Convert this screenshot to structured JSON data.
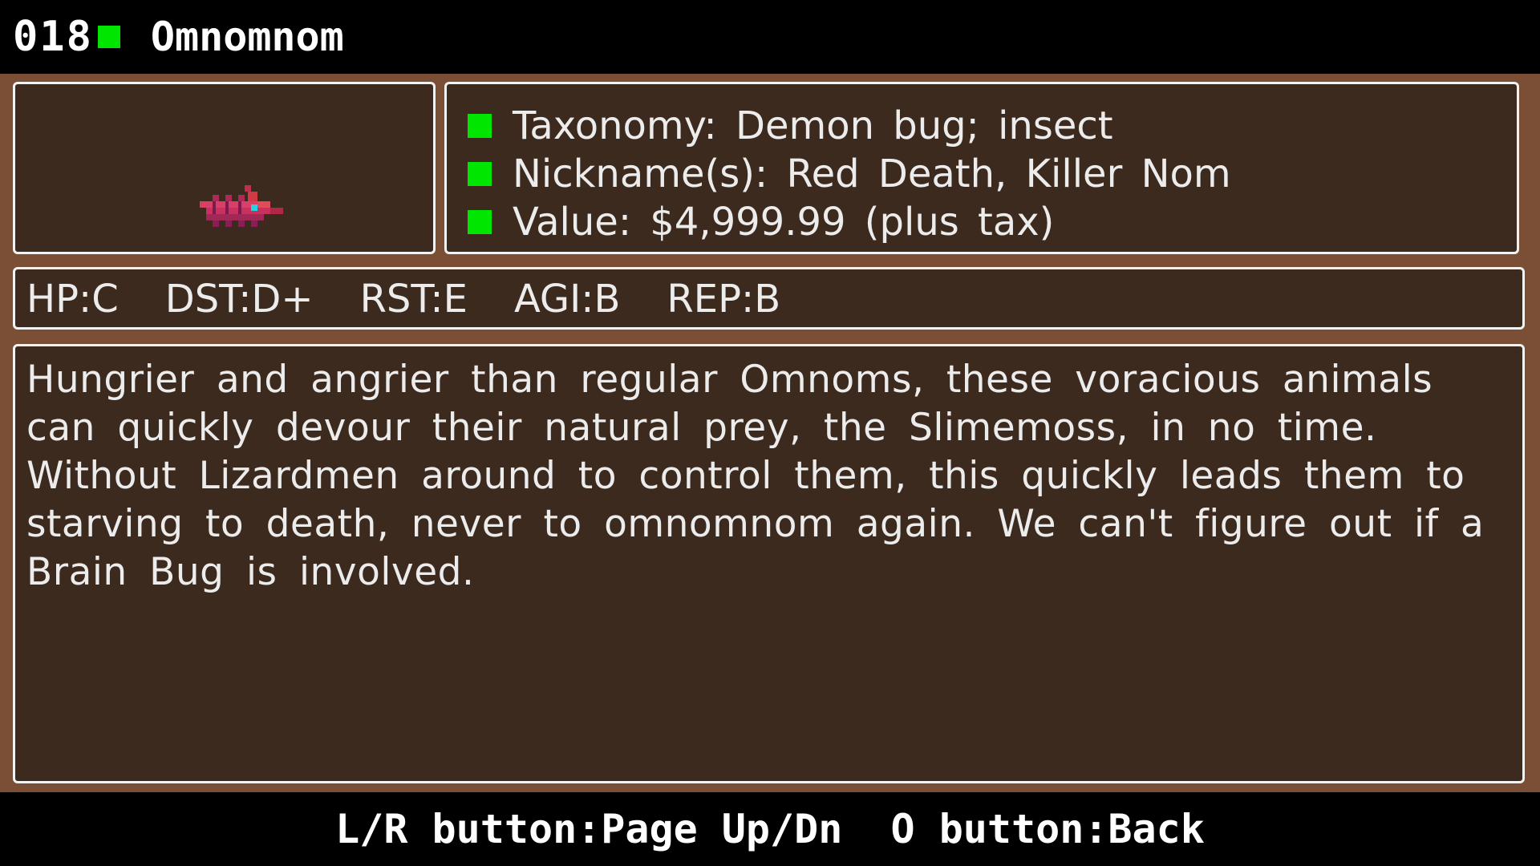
{
  "header": {
    "entry_number": "018",
    "entry_name": "Omnomnom"
  },
  "colors": {
    "accent_green": "#00e600",
    "panel_bg": "#3c2a1e",
    "frame_bg": "#7a4f36"
  },
  "sprite": {
    "icon": "omnomnom-bug-sprite"
  },
  "info": {
    "taxonomy": "Taxonomy: Demon bug; insect",
    "nicknames": "Nickname(s): Red Death, Killer Nom",
    "value": "Value: $4,999.99 (plus tax)"
  },
  "stats": {
    "hp": "HP:C",
    "dst": "DST:D+",
    "rst": "RST:E",
    "agi": "AGI:B",
    "rep": "REP:B"
  },
  "description": "Hungrier and angrier than regular Omnoms, these voracious animals can quickly devour their natural prey, the Slimemoss, in no time. Without Lizardmen around to control them, this quickly leads them to starving to death, never to omnomnom again. We can't figure out if a Brain Bug is involved.",
  "footer": {
    "hint": "L/R button:Page Up/Dn  O button:Back"
  }
}
